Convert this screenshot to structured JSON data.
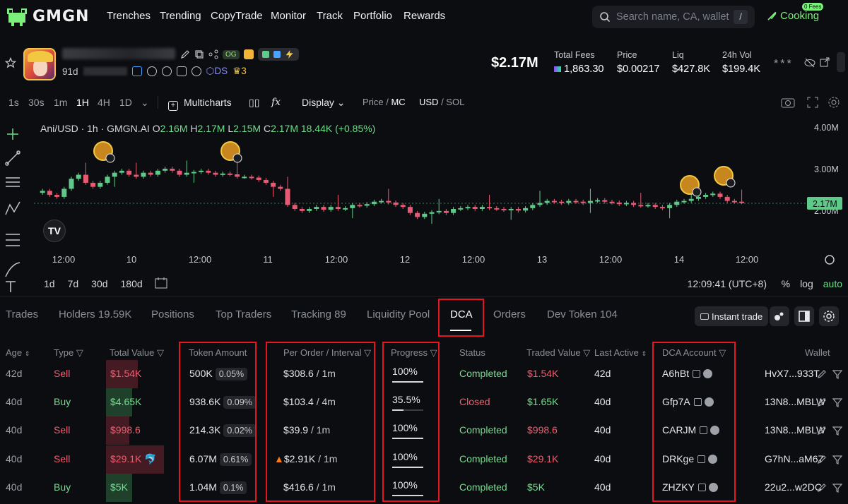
{
  "nav": {
    "logo": "GMGN",
    "items": [
      "Trenches",
      "Trending",
      "CopyTrade",
      "Monitor",
      "Track",
      "Portfolio",
      "Rewards"
    ],
    "search_placeholder": "Search name, CA, wallet",
    "search_shortcut": "/",
    "cooking_label": "Cooking",
    "fees_badge": "0 Fees"
  },
  "token": {
    "age": "91d",
    "og_badge": "OG",
    "ds_label": "DS",
    "crown_count": "3",
    "market_cap": "$2.17M",
    "stats": [
      {
        "label": "Total Fees",
        "value": "1,863.30"
      },
      {
        "label": "Price",
        "value": "$0.00217"
      },
      {
        "label": "Liq",
        "value": "$427.8K"
      },
      {
        "label": "24h Vol",
        "value": "$199.4K"
      }
    ],
    "hidden_stars": "***"
  },
  "chart_toolbar": {
    "timeframes": [
      "1s",
      "30s",
      "1m",
      "1H",
      "4H",
      "1D"
    ],
    "active_timeframe": "1H",
    "multicharts": "Multicharts",
    "display": "Display",
    "price_mc_a": "Price /",
    "price_mc_b": "MC",
    "usd_sol_a": "USD",
    "usd_sol_b": "/ SOL"
  },
  "chart": {
    "pair": "Ani/USD · 1h · GMGN.AI",
    "o_label": "O",
    "o": "2.16M",
    "h_label": "H",
    "h": "2.17M",
    "l_label": "L",
    "l": "2.15M",
    "c_label": "C",
    "c": "2.17M",
    "change": "18.44K (+0.85%)",
    "y_ticks": [
      "4.00M",
      "3.00M",
      "2.00M"
    ],
    "last_price": "2.17M",
    "x_ticks": [
      "12:00",
      "10",
      "12:00",
      "11",
      "12:00",
      "12",
      "12:00",
      "13",
      "12:00",
      "14",
      "12:00"
    ],
    "ranges": [
      "1d",
      "7d",
      "30d",
      "180d"
    ],
    "clock": "12:09:41 (UTC+8)",
    "pct": "%",
    "log": "log",
    "auto": "auto",
    "up_color": "#5fc98a",
    "down_color": "#e85a73"
  },
  "tabs": {
    "items": [
      "Trades",
      "Holders 19.59K",
      "Positions",
      "Top Traders",
      "Tracking 89",
      "Liquidity Pool",
      "DCA",
      "Orders",
      "Dev Token 104"
    ],
    "active": "DCA",
    "instant_trade": "Instant trade"
  },
  "table": {
    "headers": [
      "Age",
      "Type",
      "Total Value",
      "Token Amount",
      "Per Order / Interval",
      "Progress",
      "Status",
      "Traded Value",
      "Last Active",
      "DCA Account",
      "Wallet"
    ],
    "rows": [
      {
        "age": "42d",
        "type": "Sell",
        "total": "$1.54K",
        "amount": "500K",
        "pct": "0.05%",
        "per": "$308.6",
        "interval": "/ 1m",
        "progress": "100%",
        "progress_value": 1.0,
        "status": "Completed",
        "traded": "$1.54K",
        "last": "42d",
        "account": "A6hBt",
        "wallet": "HvX7...933T"
      },
      {
        "age": "40d",
        "type": "Buy",
        "total": "$4.65K",
        "amount": "938.6K",
        "pct": "0.09%",
        "per": "$103.4",
        "interval": "/ 4m",
        "progress": "35.5%",
        "progress_value": 0.355,
        "status": "Closed",
        "traded": "$1.65K",
        "last": "40d",
        "account": "Gfp7A",
        "wallet": "13N8...MBLW"
      },
      {
        "age": "40d",
        "type": "Sell",
        "total": "$998.6",
        "amount": "214.3K",
        "pct": "0.02%",
        "per": "$39.9",
        "interval": "/ 1m",
        "progress": "100%",
        "progress_value": 1.0,
        "status": "Completed",
        "traded": "$998.6",
        "last": "40d",
        "account": "CARJM",
        "wallet": "13N8...MBLW"
      },
      {
        "age": "40d",
        "type": "Sell",
        "total": "$29.1K",
        "amount": "6.07M",
        "pct": "0.61%",
        "per": "$2.91K",
        "interval": "/ 1m",
        "progress": "100%",
        "progress_value": 1.0,
        "status": "Completed",
        "traded": "$29.1K",
        "last": "40d",
        "account": "DRKge",
        "wallet": "G7hN...aM67"
      },
      {
        "age": "40d",
        "type": "Buy",
        "total": "$5K",
        "amount": "1.04M",
        "pct": "0.1%",
        "per": "$416.6",
        "interval": "/ 1m",
        "progress": "100%",
        "progress_value": 1.0,
        "status": "Completed",
        "traded": "$5K",
        "last": "40d",
        "account": "ZHZKY",
        "wallet": "22u2...w2DC"
      }
    ]
  },
  "colors": {
    "highlight": "#e8141e",
    "green": "#74dd8e",
    "red": "#f25c6e"
  }
}
